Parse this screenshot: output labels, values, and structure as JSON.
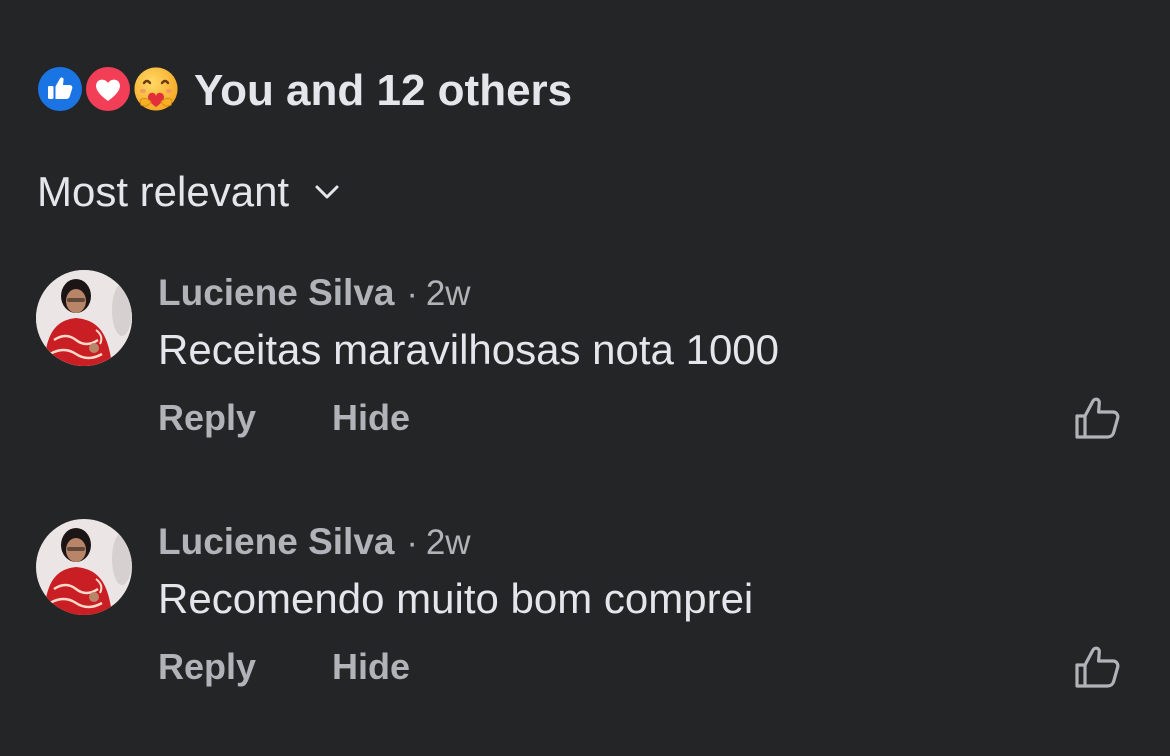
{
  "reactions": {
    "icons": [
      "like-icon",
      "love-icon",
      "care-icon"
    ],
    "summary": "You and 12 others",
    "colors": {
      "like": "#1b74e4",
      "love": "#f33e58",
      "care": "#f7b125"
    }
  },
  "sort": {
    "label": "Most relevant",
    "icon": "chevron-down-icon"
  },
  "comments": [
    {
      "author": "Luciene Silva",
      "separator": "·",
      "time": "2w",
      "text": "Receitas maravilhosas nota 1000",
      "reply_label": "Reply",
      "hide_label": "Hide",
      "like_icon": "thumbs-up-outline-icon"
    },
    {
      "author": "Luciene Silva",
      "separator": "·",
      "time": "2w",
      "text": "Recomendo muito bom comprei",
      "reply_label": "Reply",
      "hide_label": "Hide",
      "like_icon": "thumbs-up-outline-icon"
    }
  ],
  "theme": {
    "background": "#242526",
    "primary_text": "#e4e6eb",
    "secondary_text": "#b0b3b8"
  }
}
